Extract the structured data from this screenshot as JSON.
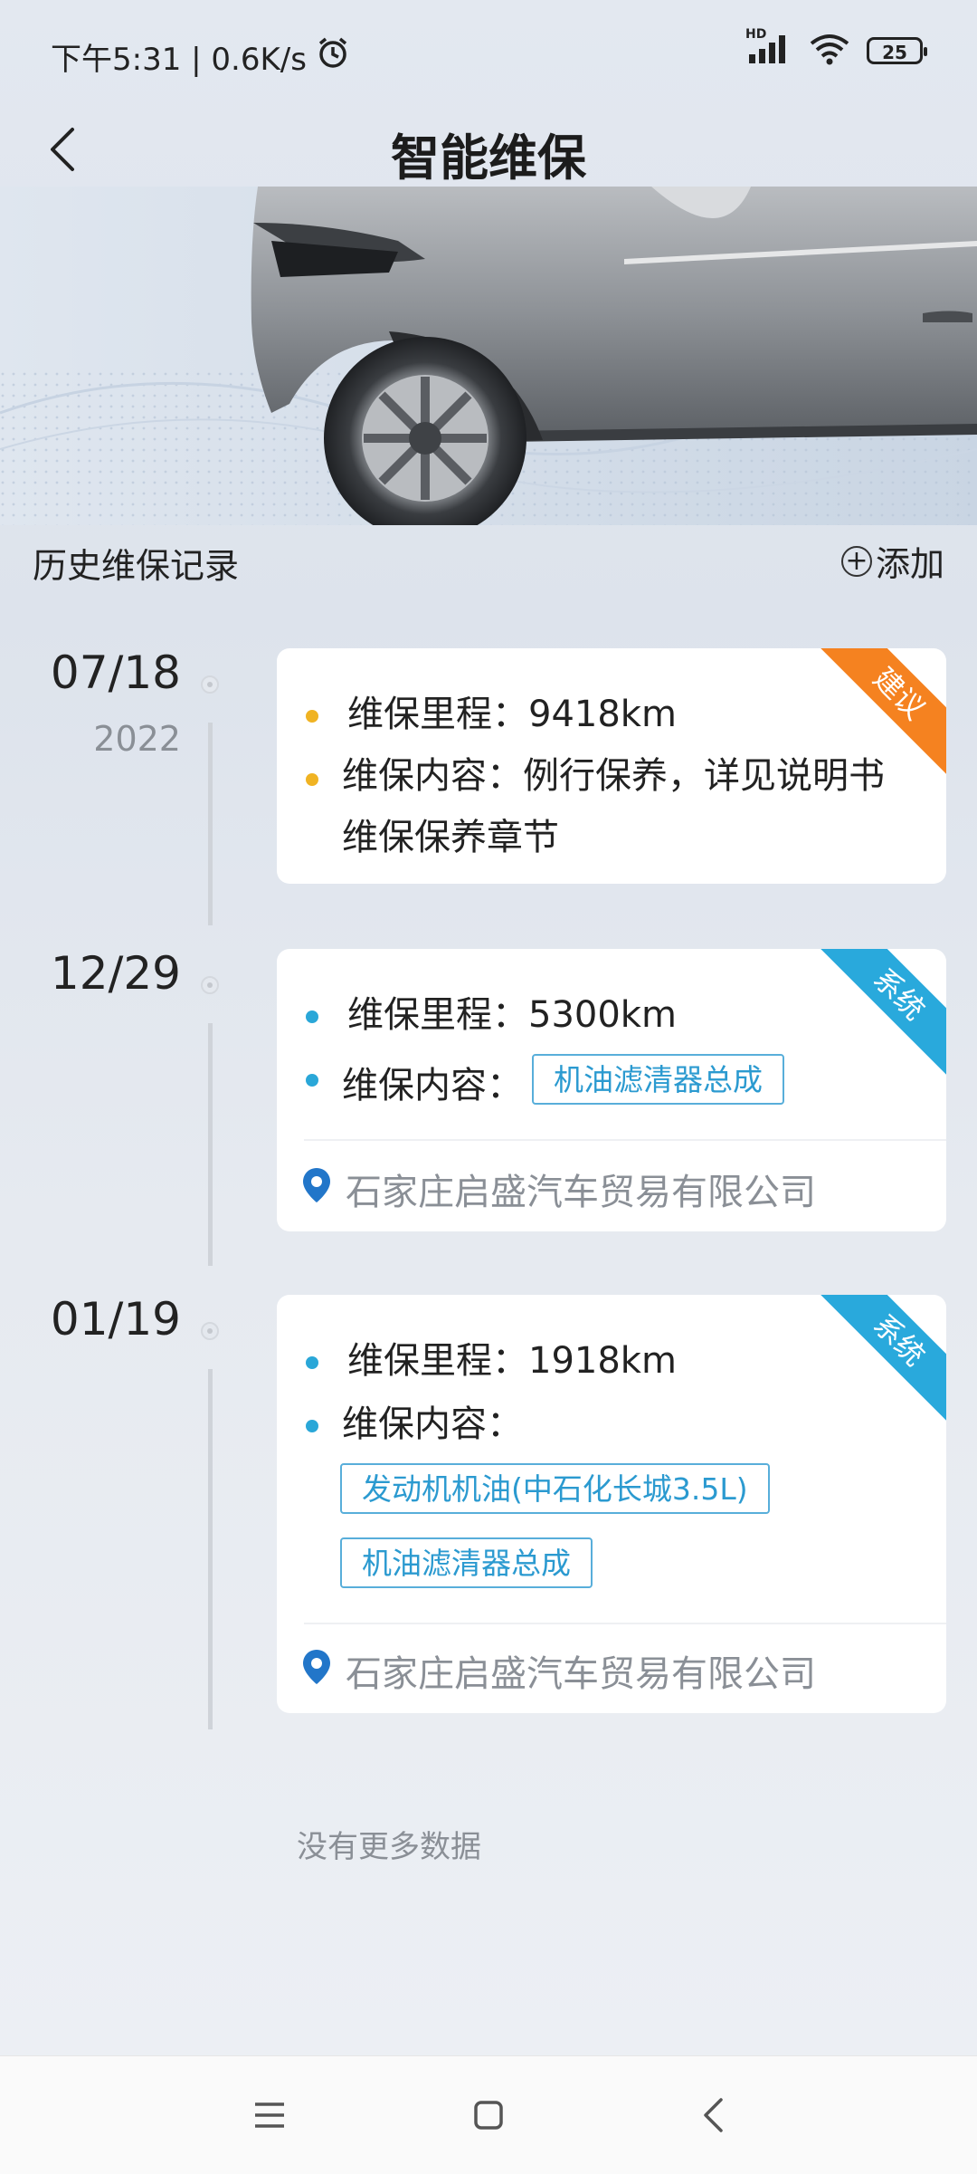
{
  "status_bar": {
    "time_speed": "下午5:31 | 0.6K/s",
    "network": "HD",
    "battery": "25"
  },
  "header": {
    "title": "智能维保",
    "back_icon": "chevron-left-icon"
  },
  "section": {
    "title": "历史维保记录",
    "add_label": "添加"
  },
  "records": [
    {
      "date": "07/18",
      "year": "2022",
      "badge": "建议",
      "badge_color": "#f58220",
      "bullet_color": "#f0b323",
      "mileage_label": "维保里程：9418km",
      "content_label": "维保内容：例行保养，详见说明书",
      "content_line2": "维保保养章节"
    },
    {
      "date": "12/29",
      "badge": "系统",
      "badge_color": "#29a9dc",
      "bullet_color": "#2aa7d8",
      "mileage_label": "维保里程：5300km",
      "content_label": "维保内容：",
      "tags": [
        "机油滤清器总成"
      ],
      "location": "石家庄启盛汽车贸易有限公司"
    },
    {
      "date": "01/19",
      "badge": "系统",
      "badge_color": "#29a9dc",
      "bullet_color": "#2aa7d8",
      "mileage_label": "维保里程：1918km",
      "content_label": "维保内容：",
      "tags": [
        "发动机机油(中石化长城3.5L)",
        "机油滤清器总成"
      ],
      "location": "石家庄启盛汽车贸易有限公司"
    }
  ],
  "footer_note": "没有更多数据",
  "nav": {
    "menu_icon": "menu-icon",
    "home_icon": "home-square-icon",
    "back_icon": "back-triangle-icon"
  }
}
